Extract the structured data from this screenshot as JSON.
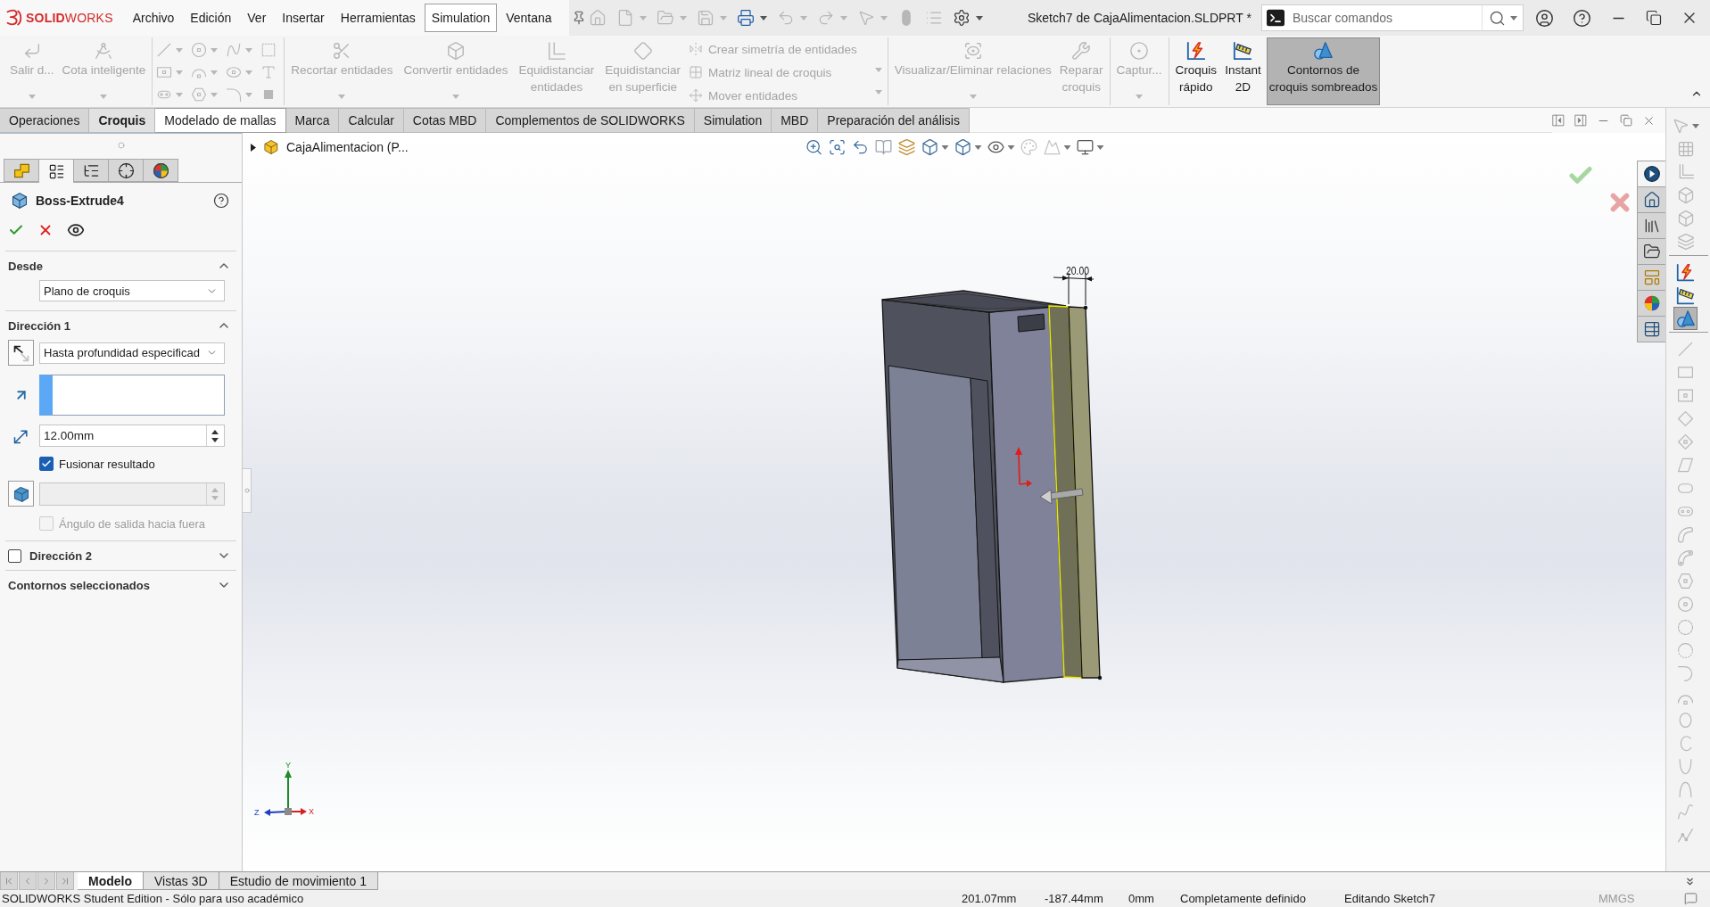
{
  "logo": {
    "text": "**SOLID**WORKS"
  },
  "menu": [
    {
      "label": "Archivo",
      "selected": false
    },
    {
      "label": "Edición",
      "selected": false
    },
    {
      "label": "Ver",
      "selected": false
    },
    {
      "label": "Insertar",
      "selected": false
    },
    {
      "label": "Herramientas",
      "selected": false
    },
    {
      "label": "Simulation",
      "selected": true
    },
    {
      "label": "Ventana",
      "selected": false
    }
  ],
  "quick_access": [
    {
      "disabled": true,
      "dropdown": false
    },
    {
      "disabled": true,
      "dropdown": true
    },
    {
      "disabled": true,
      "dropdown": true
    },
    {
      "disabled": true,
      "dropdown": true
    },
    {
      "disabled": false,
      "dropdown": true
    },
    {
      "disabled": true,
      "dropdown": true
    },
    {
      "disabled": true,
      "dropdown": true
    },
    {
      "disabled": true,
      "dropdown": true
    },
    {
      "disabled": true,
      "dropdown": false
    },
    {
      "disabled": true,
      "dropdown": false
    },
    {
      "disabled": false,
      "dropdown": true
    }
  ],
  "document_title": "Sketch7 de CajaAlimentacion.SLDPRT *",
  "search": {
    "placeholder": "Buscar comandos"
  },
  "ribbon": {
    "groups": [
      {
        "items": [
          {
            "kind": "large",
            "label": "Salir d...",
            "disabled": true,
            "dropdown": true
          },
          {
            "kind": "large",
            "label": "Cota inteligente",
            "disabled": true,
            "dropdown": true
          }
        ]
      },
      {
        "items": [
          {
            "kind": "tool_grid",
            "disabled": true
          }
        ]
      },
      {
        "items": [
          {
            "kind": "large",
            "label": "Recortar entidades",
            "disabled": true,
            "dropdown": true
          },
          {
            "kind": "large",
            "label": "Convertir entidades",
            "disabled": true,
            "dropdown": true
          },
          {
            "kind": "large",
            "label": "Equidistanciar\nentidades",
            "disabled": true,
            "dropdown": false
          },
          {
            "kind": "large",
            "label": "Equidistanciar\nen superficie",
            "disabled": true,
            "dropdown": false
          },
          {
            "kind": "small_list",
            "disabled": true,
            "entries": [
              "Crear simetría de entidades",
              "Matriz lineal de croquis",
              "Mover entidades"
            ]
          }
        ]
      },
      {
        "items": [
          {
            "kind": "large",
            "label": "Visualizar/Eliminar relaciones",
            "disabled": true,
            "dropdown": true
          },
          {
            "kind": "large",
            "label": "Reparar\ncroquis",
            "disabled": true,
            "dropdown": false
          }
        ]
      },
      {
        "items": [
          {
            "kind": "large",
            "label": "Captur...",
            "disabled": true,
            "dropdown": true
          }
        ]
      },
      {
        "items": [
          {
            "kind": "large",
            "label": "Croquis\nrápido",
            "disabled": false,
            "dropdown": false,
            "pressed": false
          },
          {
            "kind": "large",
            "label": "Instant\n2D",
            "disabled": false,
            "dropdown": false,
            "pressed": false
          },
          {
            "kind": "large",
            "label": "Contornos de\ncroquis sombreados",
            "disabled": false,
            "dropdown": false,
            "pressed": true
          }
        ]
      }
    ]
  },
  "command_tabs": [
    {
      "label": "Operaciones",
      "selected": false,
      "hovered": false
    },
    {
      "label": "Croquis",
      "selected": true,
      "hovered": false
    },
    {
      "label": "Modelado de mallas",
      "selected": false,
      "hovered": true
    },
    {
      "label": "Marca",
      "selected": false,
      "hovered": false
    },
    {
      "label": "Calcular",
      "selected": false,
      "hovered": false
    },
    {
      "label": "Cotas MBD",
      "selected": false,
      "hovered": false
    },
    {
      "label": "Complementos de SOLIDWORKS",
      "selected": false,
      "hovered": false
    },
    {
      "label": "Simulation",
      "selected": false,
      "hovered": false
    },
    {
      "label": "MBD",
      "selected": false,
      "hovered": false
    },
    {
      "label": "Preparación del análisis",
      "selected": false,
      "hovered": false
    }
  ],
  "property_manager": {
    "tabs": [
      {
        "selected": false
      },
      {
        "selected": true
      },
      {
        "selected": false
      },
      {
        "selected": false
      },
      {
        "selected": false
      }
    ],
    "title": "Boss-Extrude4",
    "sections": [
      {
        "title": "Desde",
        "expanded": true,
        "items": [
          {
            "kind": "dropdown",
            "value": "Plano de croquis"
          }
        ]
      },
      {
        "title": "Dirección 1",
        "expanded": true,
        "items": [
          {
            "kind": "button_dropdown",
            "value": "Hasta profundidad especificad"
          },
          {
            "kind": "selection"
          },
          {
            "kind": "spin",
            "value": "12.00mm",
            "disabled": false
          },
          {
            "kind": "checkbox",
            "label": "Fusionar resultado",
            "checked": true,
            "disabled": false
          },
          {
            "kind": "button_spin",
            "disabled": true
          },
          {
            "kind": "checkbox",
            "label": "Ángulo de salida hacia fuera",
            "checked": false,
            "disabled": true
          }
        ]
      },
      {
        "title": "Dirección 2",
        "expanded": false,
        "checked": false
      },
      {
        "title": "Contornos seleccionados",
        "expanded": false
      }
    ]
  },
  "viewport": {
    "tree_flyout": {
      "label": "CajaAlimentacion (P...",
      "expanded": false
    },
    "dimension": "20.00",
    "triad": {
      "x": "X",
      "y": "Y",
      "z": "Z"
    }
  },
  "task_pane": [
    {
      "selected": true
    },
    {
      "selected": false
    },
    {
      "selected": false
    },
    {
      "selected": false
    },
    {
      "selected": false
    },
    {
      "selected": false
    },
    {
      "selected": false
    }
  ],
  "side_toolbar": {
    "view_tools": {
      "disabled": true
    },
    "mode_tools": [
      {
        "pressed": false
      },
      {
        "pressed": false
      },
      {
        "pressed": true
      }
    ],
    "entity_tools": {
      "disabled": true
    }
  },
  "bottom_tabs": [
    {
      "label": "Modelo",
      "selected": true
    },
    {
      "label": "Vistas 3D",
      "selected": false
    },
    {
      "label": "Estudio de movimiento 1",
      "selected": false
    }
  ],
  "status_bar": {
    "text": "SOLIDWORKS Student Edition - Sólo para uso académico",
    "readouts": [
      "201.07mm",
      "-187.44mm",
      "0mm"
    ],
    "sketch_state": "Completamente definido",
    "editing": "Editando Sketch7",
    "units": "MMGS"
  }
}
